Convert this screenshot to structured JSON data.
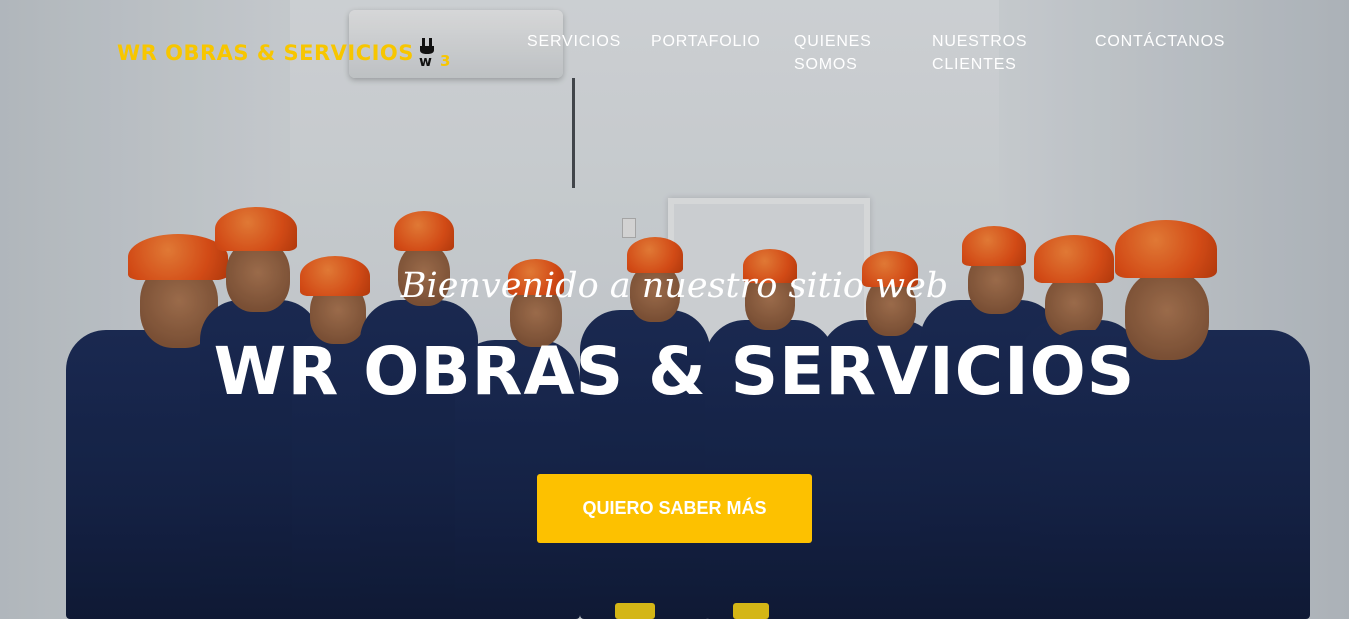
{
  "brand": {
    "logo_text": "WR OBRAS & SERVICIOS",
    "logo_icon": "w3-plug-logo-icon",
    "accent_color": "#f7c600"
  },
  "nav": {
    "items": [
      {
        "label": "SERVICIOS"
      },
      {
        "label": "PORTAFOLIO"
      },
      {
        "label": "QUIENES SOMOS"
      },
      {
        "label": "NUESTROS CLIENTES"
      },
      {
        "label": "CONTÁCTANOS"
      }
    ]
  },
  "hero": {
    "subtitle": "Bienvenido a nuestro sitio web",
    "title": "WR OBRAS & SERVICIOS",
    "cta_label": "QUIERO SABER MÁS",
    "cta_color": "#fdc100"
  }
}
